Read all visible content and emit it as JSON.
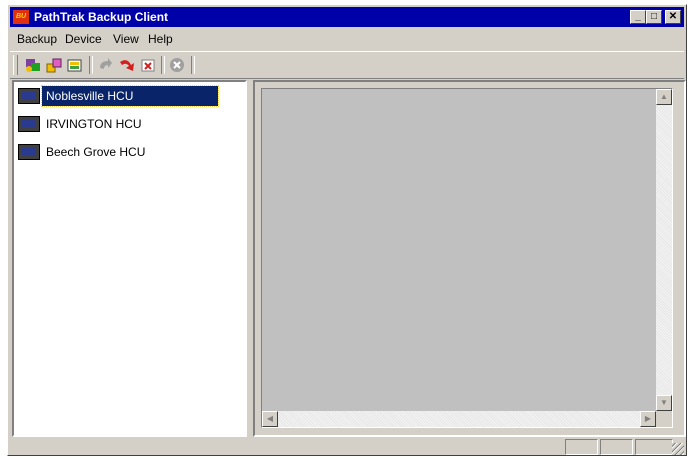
{
  "window": {
    "title": "PathTrak Backup Client",
    "app_icon_text": "BU"
  },
  "title_buttons": {
    "minimize": "_",
    "maximize": "□",
    "close": "✕"
  },
  "menu": [
    {
      "label": "Backup"
    },
    {
      "label": "Device"
    },
    {
      "label": "View"
    },
    {
      "label": "Help"
    }
  ],
  "toolbar": {
    "tools": [
      "connect-icon",
      "add-device-icon",
      "properties-icon",
      "undo-icon",
      "redo-icon",
      "delete-icon",
      "stop-icon"
    ]
  },
  "devices": [
    {
      "label": "Noblesville HCU",
      "selected": true
    },
    {
      "label": "IRVINGTON HCU",
      "selected": false
    },
    {
      "label": "Beech Grove HCU",
      "selected": false
    }
  ],
  "scroll": {
    "up": "▲",
    "down": "▼",
    "left": "◀",
    "right": "▶"
  },
  "colors": {
    "titlebar": "#0000a8",
    "selection": "#0a246a",
    "face": "#d4d0c8"
  }
}
